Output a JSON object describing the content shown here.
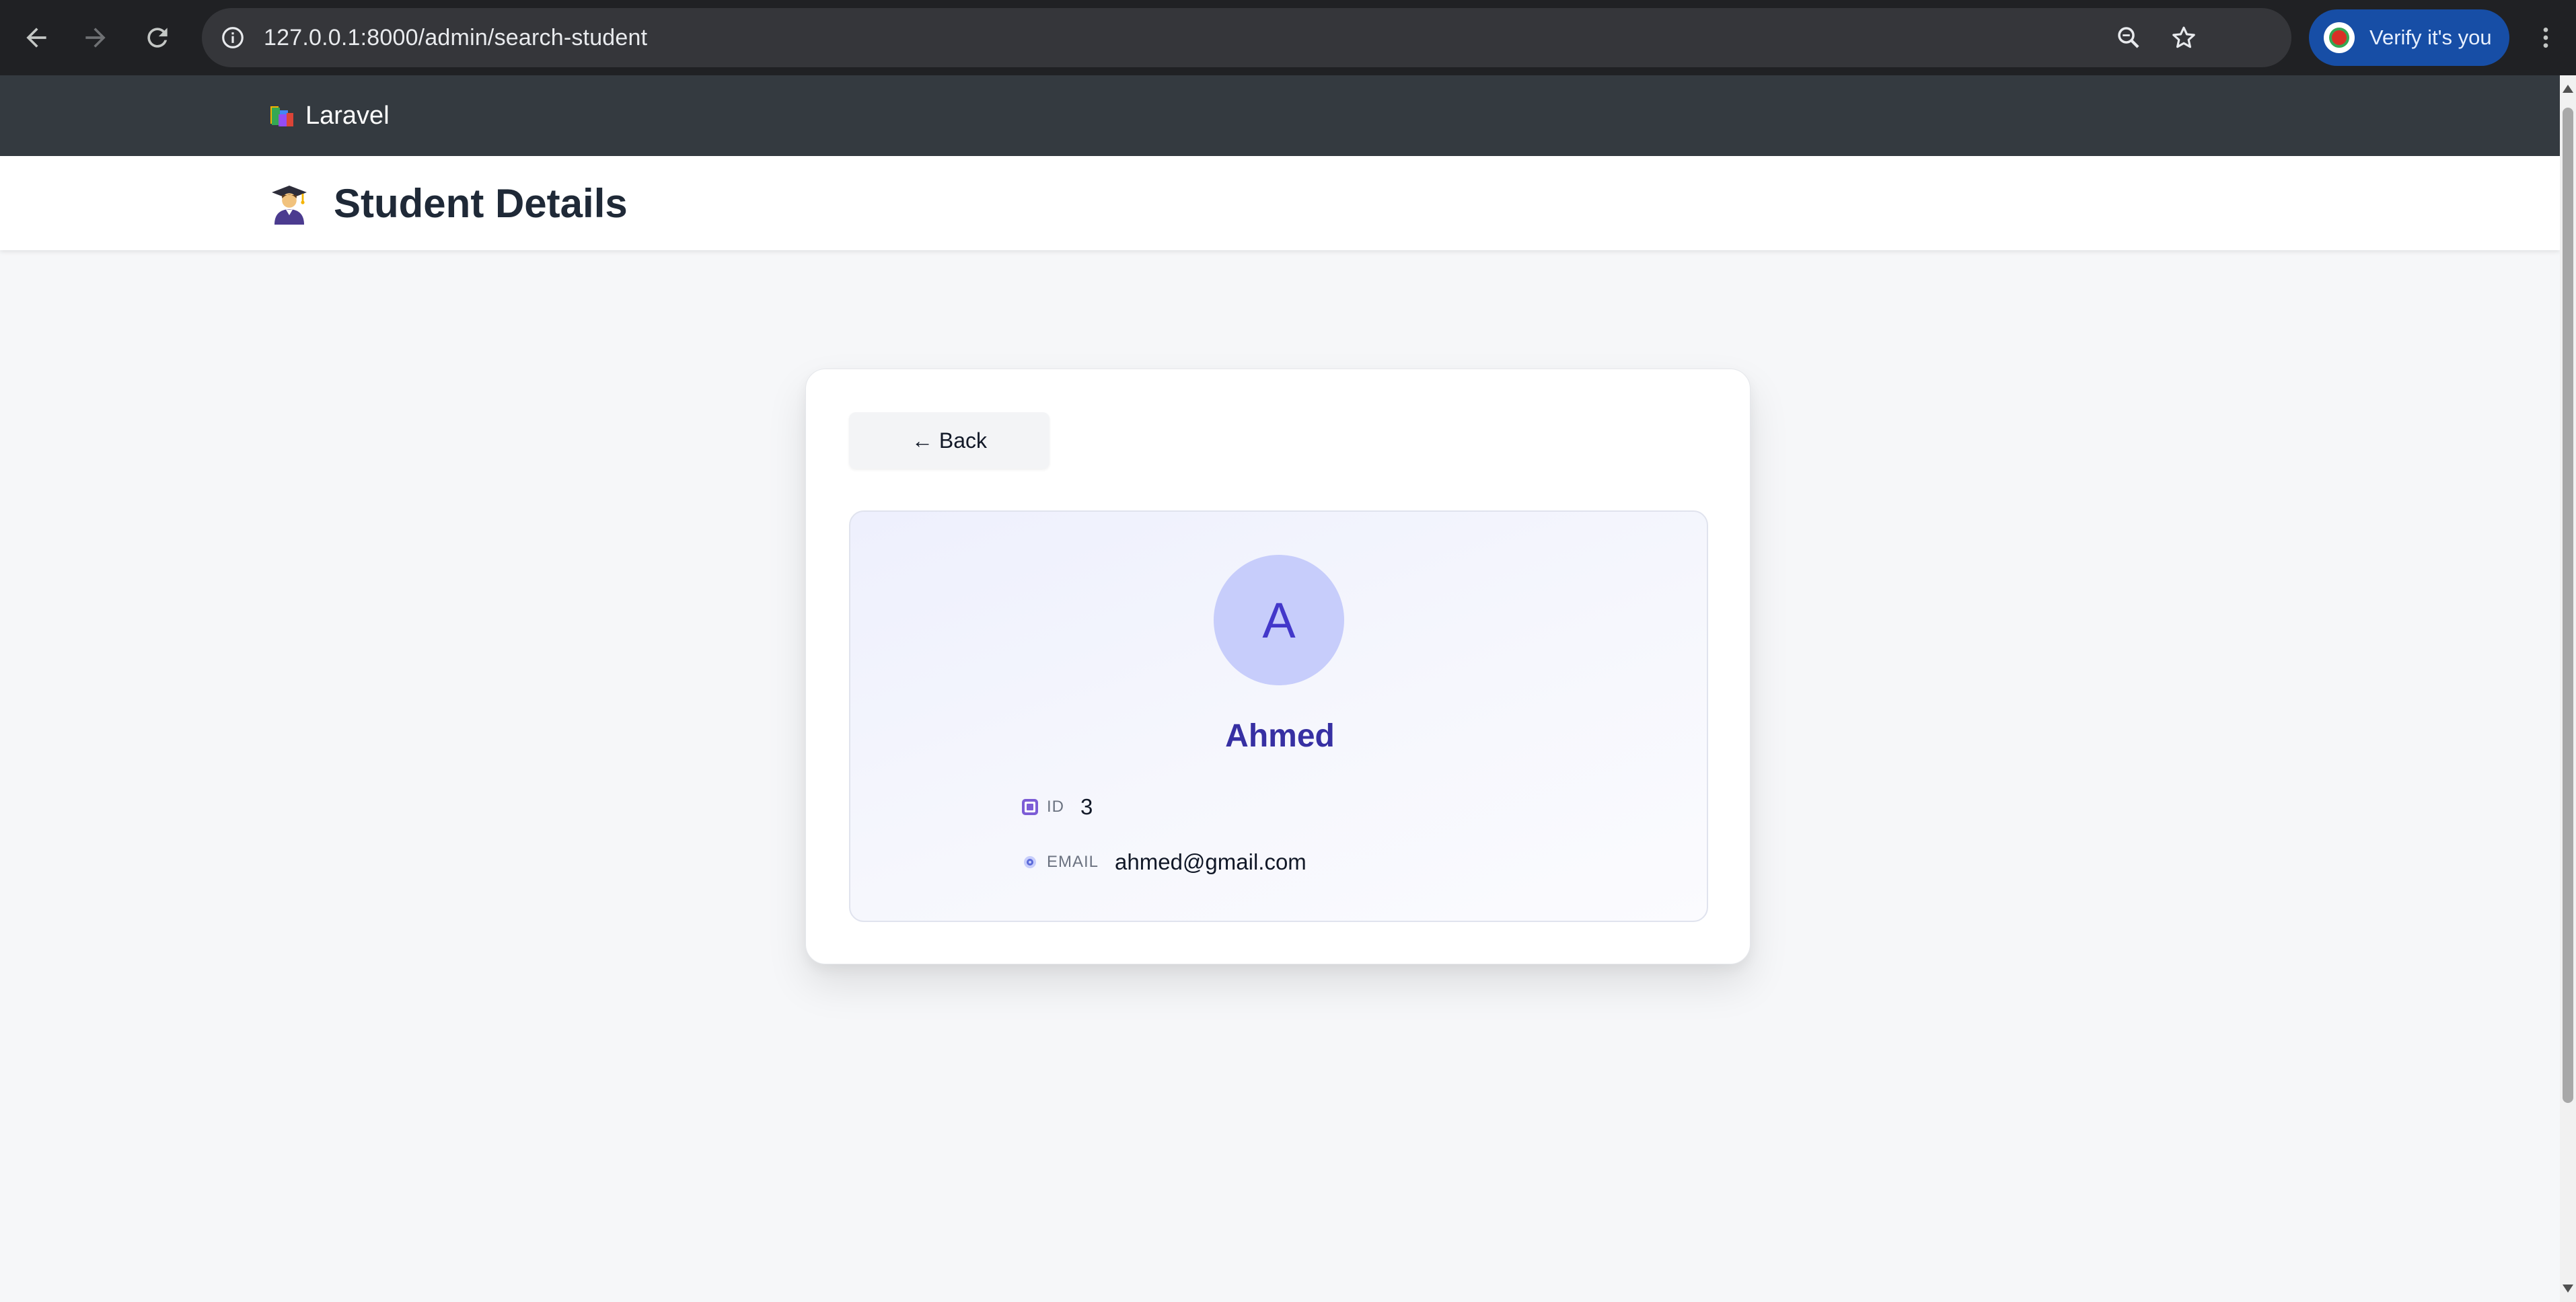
{
  "browser": {
    "url": "127.0.0.1:8000/admin/search-student",
    "verify_label": "Verify it's you",
    "icons": [
      "back-arrow-icon",
      "forward-arrow-icon",
      "reload-icon",
      "site-info-icon",
      "zoom-icon",
      "bookmark-star-icon",
      "more-vert-icon"
    ]
  },
  "navbar": {
    "brand": "Laravel",
    "brand_icon": "books-icon"
  },
  "header": {
    "title": "Student Details",
    "icon": "student-graduate-icon"
  },
  "card": {
    "back_label": "← Back",
    "avatar_letter": "A",
    "name": "Ahmed",
    "fields": [
      {
        "key": "ID",
        "value": "3",
        "icon": "id-card-icon"
      },
      {
        "key": "EMAIL",
        "value": "ahmed@gmail.com",
        "icon": "email-icon"
      }
    ]
  },
  "colors": {
    "chrome_bg": "#202124",
    "navbar_bg": "#343a40",
    "accent": "#3730a3",
    "avatar_bg": "#c7cdfb",
    "verify_bg": "#174ea6"
  }
}
